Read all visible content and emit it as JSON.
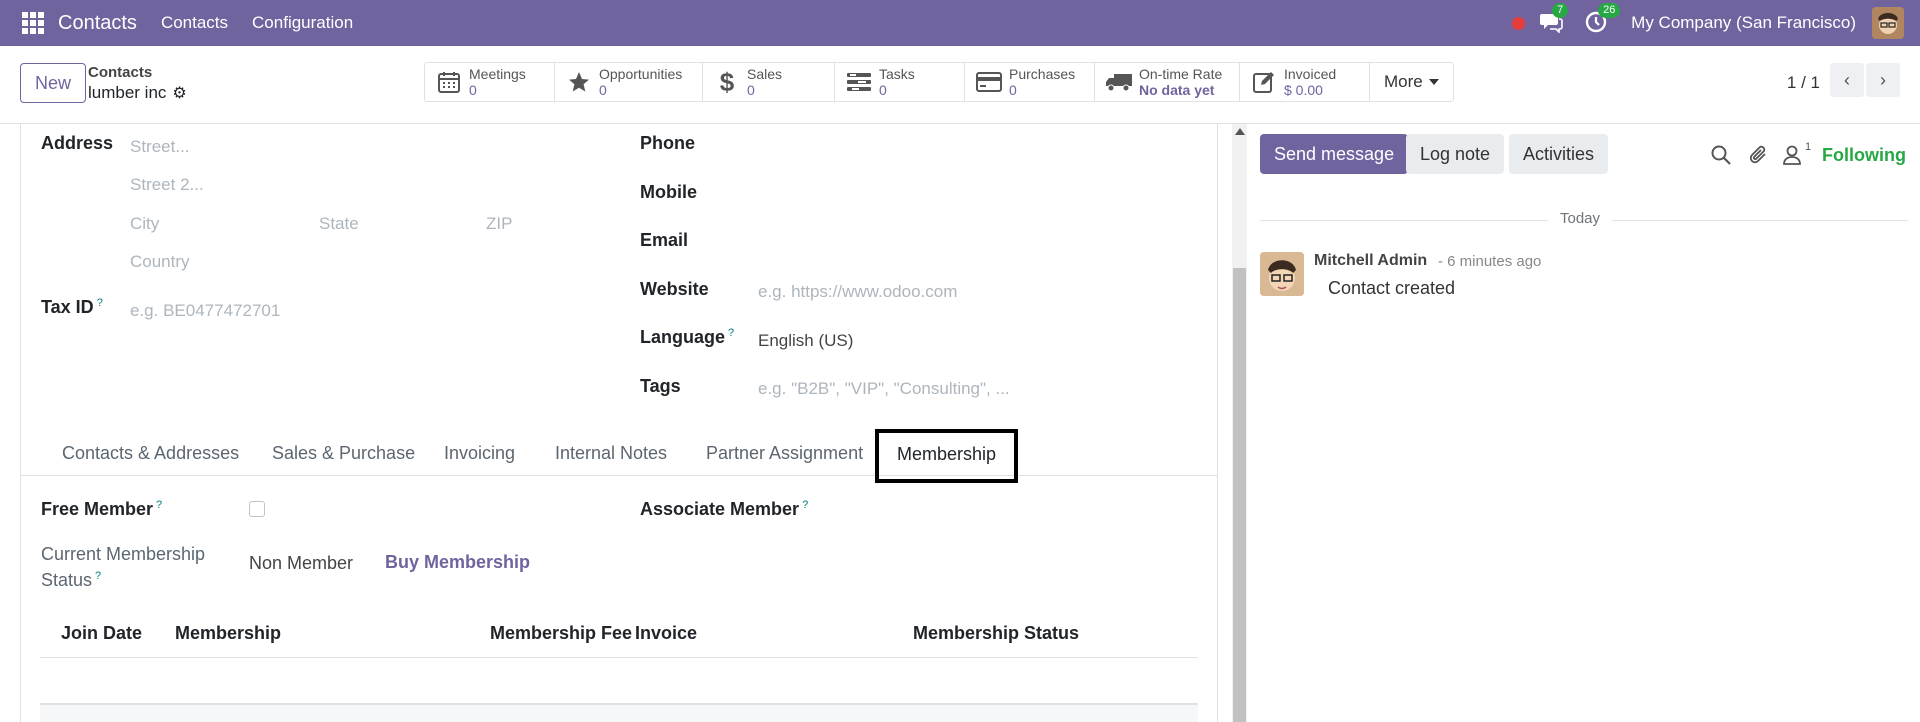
{
  "navbar": {
    "brand": "Contacts",
    "menu": [
      "Contacts",
      "Configuration"
    ],
    "messages_badge": "7",
    "activities_badge": "26",
    "company": "My Company (San Francisco)"
  },
  "control": {
    "new_label": "New",
    "breadcrumb_parent": "Contacts",
    "record_name": "lumber inc",
    "stats": [
      {
        "label": "Meetings",
        "value": "0",
        "icon": "calendar-icon"
      },
      {
        "label": "Opportunities",
        "value": "0",
        "icon": "star-icon"
      },
      {
        "label": "Sales",
        "value": "0",
        "icon": "dollar-icon"
      },
      {
        "label": "Tasks",
        "value": "0",
        "icon": "tasks-icon"
      },
      {
        "label": "Purchases",
        "value": "0",
        "icon": "credit-card-icon"
      },
      {
        "label": "On-time Rate",
        "value": "No data yet",
        "icon": "truck-icon"
      },
      {
        "label": "Invoiced",
        "value": "$ 0.00",
        "icon": "edit-icon"
      }
    ],
    "more_label": "More",
    "pager": "1 / 1"
  },
  "form": {
    "address_label": "Address",
    "street_ph": "Street...",
    "street2_ph": "Street 2...",
    "city_ph": "City",
    "state_ph": "State",
    "zip_ph": "ZIP",
    "country_ph": "Country",
    "taxid_label": "Tax ID",
    "taxid_ph": "e.g. BE0477472701",
    "phone_label": "Phone",
    "mobile_label": "Mobile",
    "email_label": "Email",
    "website_label": "Website",
    "website_ph": "e.g. https://www.odoo.com",
    "language_label": "Language",
    "language_value": "English (US)",
    "tags_label": "Tags",
    "tags_ph": "e.g. \"B2B\", \"VIP\", \"Consulting\", ...",
    "help_mark": "?"
  },
  "tabs": [
    "Contacts & Addresses",
    "Sales & Purchase",
    "Invoicing",
    "Internal Notes",
    "Partner Assignment",
    "Membership"
  ],
  "membership": {
    "free_member_label": "Free Member",
    "associate_label": "Associate Member",
    "status_label_1": "Current Membership",
    "status_label_2": "Status",
    "status_value": "Non Member",
    "buy_label": "Buy Membership",
    "columns": [
      "Join Date",
      "Membership",
      "Membership Fee",
      "Invoice",
      "Membership Status"
    ]
  },
  "chatter": {
    "send_label": "Send message",
    "log_label": "Log note",
    "activities_label": "Activities",
    "follower_count": "1",
    "following_label": "Following",
    "today_label": "Today",
    "author": "Mitchell Admin",
    "time": "- 6 minutes ago",
    "body": "Contact created"
  }
}
